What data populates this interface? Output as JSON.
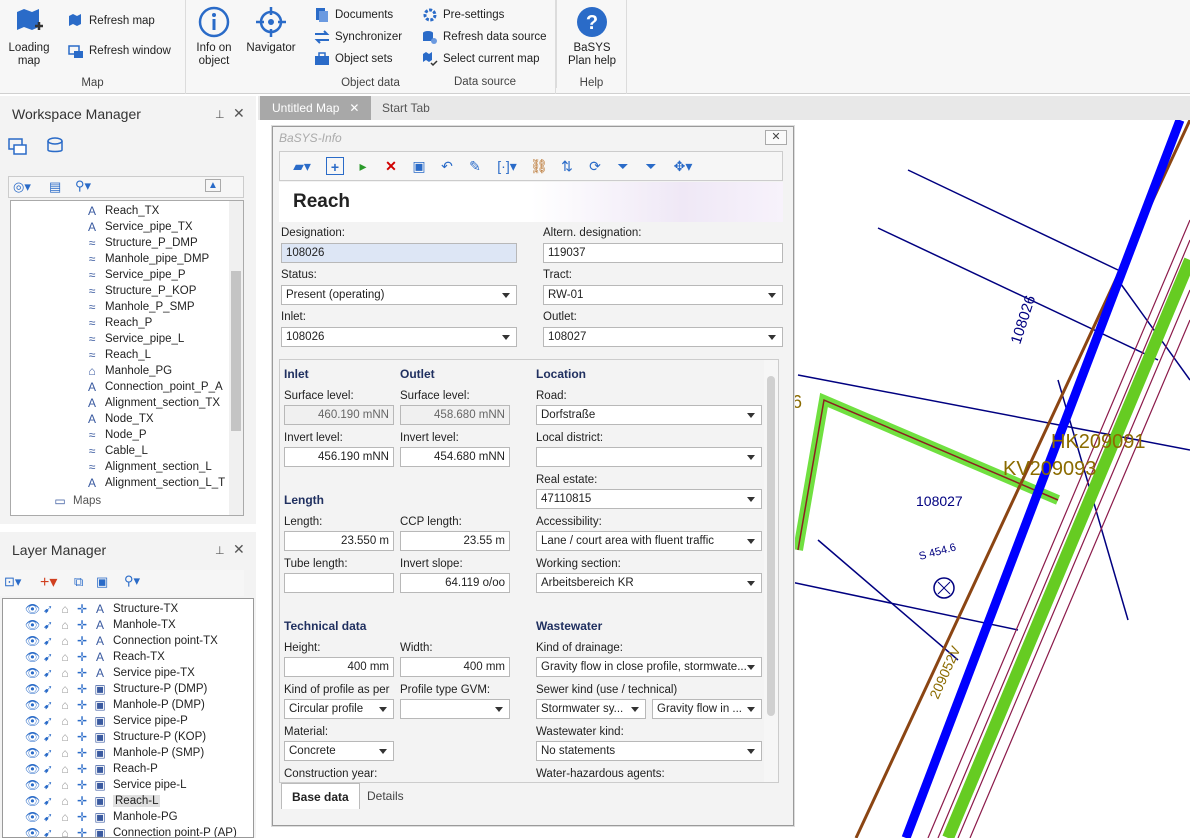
{
  "ribbon": {
    "groups": {
      "map": {
        "label": "Map",
        "loading": "Loading map",
        "refresh_map": "Refresh map",
        "refresh_window": "Refresh window"
      },
      "object_data": {
        "label": "Object data",
        "info": "Info on object",
        "navigator": "Navigator",
        "documents": "Documents",
        "synchronizer": "Synchronizer",
        "object_sets": "Object sets"
      },
      "data_source": {
        "label": "Data source",
        "presettings": "Pre-settings",
        "refresh_ds": "Refresh data source",
        "select_map": "Select current map"
      },
      "help": {
        "label": "Help",
        "basys_help": "BaSYS Plan help"
      }
    }
  },
  "workspace": {
    "title": "Workspace Manager",
    "items": [
      "Reach_TX",
      "Service_pipe_TX",
      "Structure_P_DMP",
      "Manhole_pipe_DMP",
      "Service_pipe_P",
      "Structure_P_KOP",
      "Manhole_P_SMP",
      "Reach_P",
      "Service_pipe_L",
      "Reach_L",
      "Manhole_PG",
      "Connection_point_P_A",
      "Alignment_section_TX",
      "Node_TX",
      "Node_P",
      "Cable_L",
      "Alignment_section_L",
      "Alignment_section_L_T"
    ],
    "maps_label": "Maps"
  },
  "layers": {
    "title": "Layer Manager",
    "items": [
      "Structure-TX",
      "Manhole-TX",
      "Connection point-TX",
      "Reach-TX",
      "Service pipe-TX",
      "Structure-P (DMP)",
      "Manhole-P (DMP)",
      "Service pipe-P",
      "Structure-P (KOP)",
      "Manhole-P (SMP)",
      "Reach-P",
      "Service pipe-L",
      "Reach-L",
      "Manhole-PG",
      "Connection point-P (AP)"
    ]
  },
  "tabs": [
    "Untitled Map",
    "Start Tab"
  ],
  "dialog": {
    "title": "BaSYS-Info",
    "heading": "Reach",
    "designation_label": "Designation:",
    "designation": "108026",
    "altern_label": "Altern. designation:",
    "altern": "119037",
    "status_label": "Status:",
    "status": "Present (operating)",
    "tract_label": "Tract:",
    "tract": "RW-01",
    "inlet_label": "Inlet:",
    "inlet": "108026",
    "outlet_label": "Outlet:",
    "outlet": "108027",
    "sec_inlet": "Inlet",
    "sec_outlet": "Outlet",
    "sec_location": "Location",
    "surface_label": "Surface level:",
    "inlet_surface": "460.190 mNN",
    "outlet_surface": "458.680 mNN",
    "invert_label": "Invert level:",
    "inlet_invert": "456.190 mNN",
    "outlet_invert": "454.680 mNN",
    "road_label": "Road:",
    "road": "Dorfstraße",
    "district_label": "Local district:",
    "district": "",
    "estate_label": "Real estate:",
    "estate": "47110815",
    "sec_length": "Length",
    "length_label": "Length:",
    "length": "23.550 m",
    "ccp_label": "CCP length:",
    "ccp": "23.55 m",
    "access_label": "Accessibility:",
    "access": "Lane / court area with fluent traffic",
    "tube_label": "Tube length:",
    "tube": "",
    "slope_label": "Invert slope:",
    "slope": "64.119 o/oo",
    "working_label": "Working section:",
    "working": "Arbeitsbereich KR",
    "sec_tech": "Technical data",
    "sec_waste": "Wastewater",
    "height_label": "Height:",
    "height": "400 mm",
    "width_label": "Width:",
    "width": "400 mm",
    "drainage_label": "Kind of drainage:",
    "drainage": "Gravity flow in close profile, stormwate...",
    "profile_label": "Kind of profile as per",
    "profile": "Circular profile",
    "gvm_label": "Profile type GVM:",
    "gvm": "",
    "sewer_label": "Sewer kind (use / technical)",
    "sewer1": "Stormwater sy...",
    "sewer2": "Gravity flow in ...",
    "material_label": "Material:",
    "material": "Concrete",
    "wwkind_label": "Wastewater kind:",
    "wwkind": "No statements",
    "year_label": "Construction year:",
    "hazard_label": "Water-hazardous agents:",
    "tab_base": "Base data",
    "tab_details": "Details"
  },
  "map_labels": {
    "hk": "HK209091",
    "kv": "KV209093",
    "node": "108027",
    "reach": "108026",
    "r2": "209052V",
    "num": "6",
    "elev": "S 454.6"
  }
}
